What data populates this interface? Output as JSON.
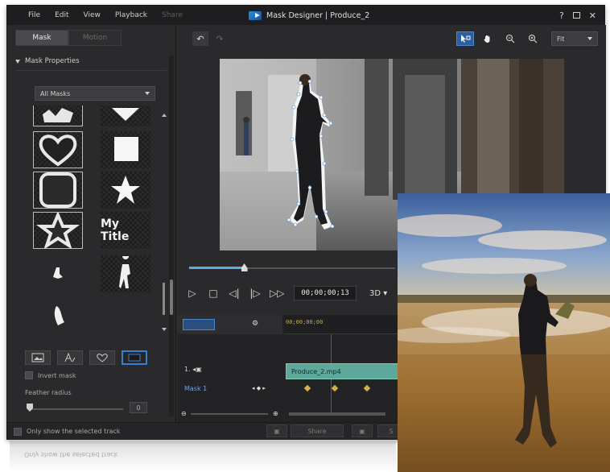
{
  "menu": [
    "File",
    "Edit",
    "View",
    "Playback",
    "Share"
  ],
  "window_title": "Mask Designer | Produce_2",
  "window_controls": {
    "help": "?",
    "close": "✕"
  },
  "left_tabs": [
    "Mask",
    "Motion"
  ],
  "section_title": "Mask Properties",
  "mask_filter": "All Masks",
  "mask_tiles": {
    "title_tile_label": "My Title"
  },
  "invert_mask_label": "Invert mask",
  "feather_label": "Feather radius",
  "feather_value": "0",
  "zoom_level": "Fit",
  "timecode": "00;00;00;13",
  "view_mode": "3D",
  "timeline": {
    "ruler_start": "00;00;00;00",
    "track_1_label": "1.",
    "clip_name": "Produce_2.mp4",
    "mask_track_label": "Mask 1",
    "playback_progress": 0.26
  },
  "status_text": "Only show the selected track",
  "bottom_buttons": [
    "Share",
    "S"
  ],
  "reflection_text": "Only show the selected track"
}
